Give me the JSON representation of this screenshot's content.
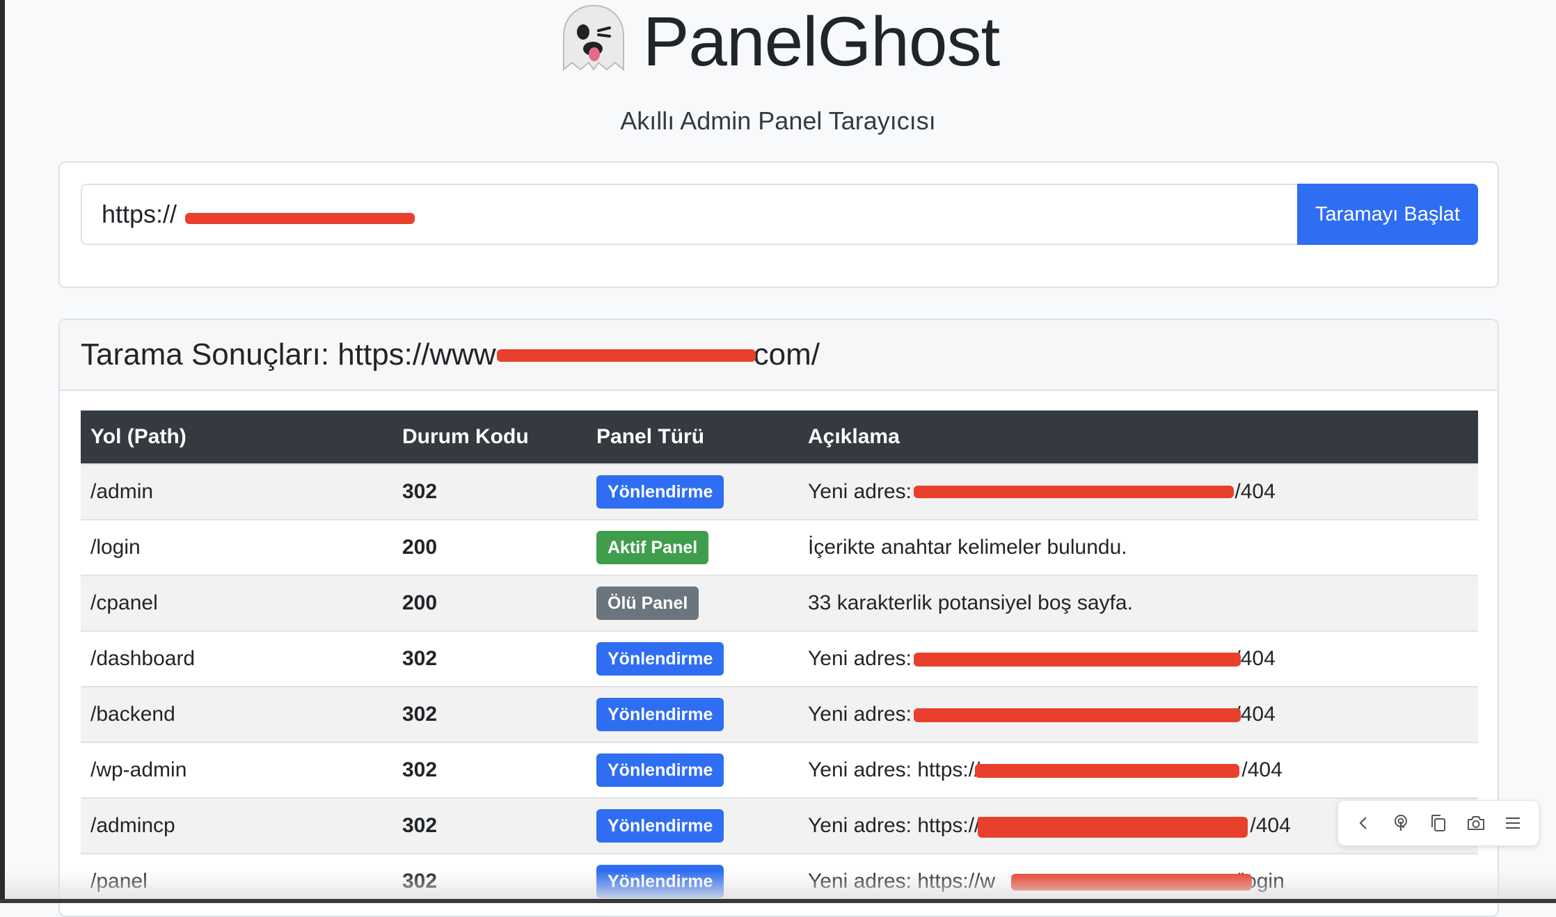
{
  "app": {
    "title": "PanelGhost",
    "subtitle": "Akıllı Admin Panel Tarayıcısı",
    "logo_icon": "ghost-emoji"
  },
  "scan": {
    "url_value": "https://",
    "scan_button": "Taramayı Başlat"
  },
  "results": {
    "title_prefix": "Tarama Sonuçları: https://www",
    "title_suffix": "com/",
    "columns": [
      "Yol (Path)",
      "Durum Kodu",
      "Panel Türü",
      "Açıklama"
    ],
    "rows": [
      {
        "path": "/admin",
        "code": "302",
        "type": "Yönlendirme",
        "desc": "Yeni adres:",
        "desc_end": "/404"
      },
      {
        "path": "/login",
        "code": "200",
        "type": "Aktif Panel",
        "desc": "İçerikte anahtar kelimeler bulundu.",
        "desc_end": ""
      },
      {
        "path": "/cpanel",
        "code": "200",
        "type": "Ölü Panel",
        "desc": "33 karakterlik potansiyel boş sayfa.",
        "desc_end": ""
      },
      {
        "path": "/dashboard",
        "code": "302",
        "type": "Yönlendirme",
        "desc": "Yeni adres:",
        "desc_end": "/404"
      },
      {
        "path": "/backend",
        "code": "302",
        "type": "Yönlendirme",
        "desc": "Yeni adres:",
        "desc_end": "/404"
      },
      {
        "path": "/wp-admin",
        "code": "302",
        "type": "Yönlendirme",
        "desc": "Yeni adres: https://",
        "desc_end": "/404"
      },
      {
        "path": "/admincp",
        "code": "302",
        "type": "Yönlendirme",
        "desc": "Yeni adres: https://",
        "desc_end": "/404"
      },
      {
        "path": "/panel",
        "code": "302",
        "type": "Yönlendirme",
        "desc": "Yeni adres: https://w",
        "desc_end": "/login"
      }
    ]
  },
  "colors": {
    "primary": "#2f6ef2",
    "success": "#3f9e4c",
    "secondary": "#6c757d",
    "table_header": "#343a40",
    "redaction": "#e8402c"
  },
  "toolbar": {
    "icons": [
      "chevron-left-icon",
      "touch-icon",
      "copy-icon",
      "camera-icon",
      "menu-icon"
    ]
  }
}
